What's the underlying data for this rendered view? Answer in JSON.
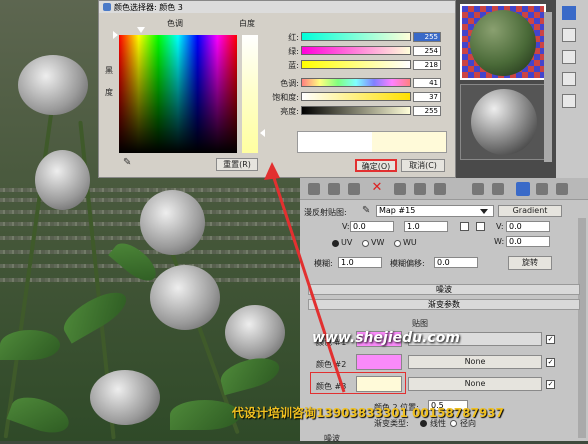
{
  "dialog": {
    "title": "颜色选择器: 颜色 3",
    "hue_header": "色调",
    "whiteness_header": "白度",
    "blackness_label_1": "黑",
    "blackness_label_2": "度",
    "reset_button": "重置(R)",
    "ok_button": "确定(O)",
    "cancel_button": "取消(C)",
    "channels": [
      {
        "label": "红:",
        "value": "255",
        "selected": true
      },
      {
        "label": "绿:",
        "value": "254"
      },
      {
        "label": "蓝:",
        "value": "218"
      },
      {
        "label": "色调:",
        "value": "41"
      },
      {
        "label": "饱和度:",
        "value": "37"
      },
      {
        "label": "亮度:",
        "value": "255"
      }
    ]
  },
  "editor": {
    "diffuse_label": "漫反射贴图:",
    "map_name": "Map #15",
    "map_type": "Gradient",
    "v_label": "V:",
    "v_value1": "0.0",
    "v_value2": "1.0",
    "w_label": "W:",
    "w_value": "0.0",
    "uv": "UV",
    "vw": "VW",
    "wu": "WU",
    "blur_label": "模糊:",
    "blur_value": "1.0",
    "blur_offset_label": "模糊偏移:",
    "blur_offset_value": "0.0",
    "rotate_button": "旋转",
    "noise_rollout": "噪波",
    "gradient_rollout": "渐变参数",
    "maps_header": "贴图",
    "color1_label": "颜色 #1",
    "color2_label": "颜色 #2",
    "color3_label": "颜色 #3",
    "map1": "",
    "none2": "None",
    "none3": "None",
    "color2_pos_label": "颜色 2 位置:",
    "color2_pos_value": "0.5",
    "grad_type_label": "渐变类型:",
    "linear": "线性",
    "radial": "径向",
    "noise_label": "噪波"
  },
  "watermark": "www.shejiedu.com",
  "footer_text": "代设计培训咨询13903833301  00158787937"
}
